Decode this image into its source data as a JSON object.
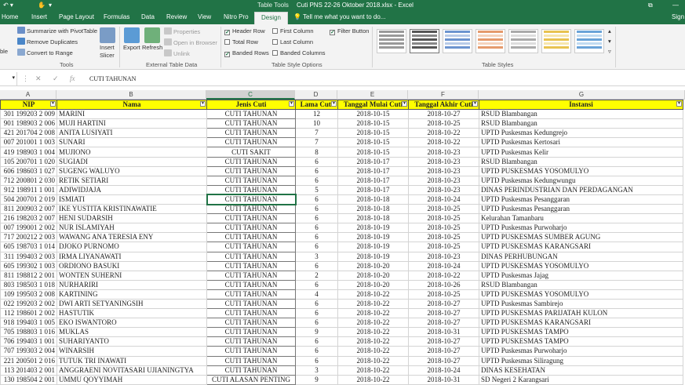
{
  "window": {
    "title": "Cuti PNS 22-26 Oktober 2018.xlsx - Excel",
    "context_tab": "Table Tools",
    "restore_icon": "restore-window-icon",
    "signin": "Sign"
  },
  "tabs": [
    "Home",
    "Insert",
    "Page Layout",
    "Formulas",
    "Data",
    "Review",
    "View",
    "Nitro Pro",
    "Design"
  ],
  "active_tab": "Design",
  "tell_me": "Tell me what you want to do...",
  "ribbon": {
    "tools": {
      "summarize": "Summarize with PivotTable",
      "remove_duplicates": "Remove Duplicates",
      "convert_range": "Convert to Range",
      "left_cut": "ble",
      "insert_slicer_1": "Insert",
      "insert_slicer_2": "Slicer",
      "group": "Tools"
    },
    "external": {
      "export": "Export",
      "refresh": "Refresh",
      "properties": "Properties",
      "open_browser": "Open in Browser",
      "unlink": "Unlink",
      "group": "External Table Data"
    },
    "style_options": {
      "header_row": "Header Row",
      "total_row": "Total Row",
      "banded_rows": "Banded Rows",
      "first_column": "First Column",
      "last_column": "Last Column",
      "banded_columns": "Banded Columns",
      "filter_button": "Filter Button",
      "group": "Table Style Options",
      "checked": {
        "header_row": true,
        "total_row": false,
        "banded_rows": true,
        "first_column": false,
        "last_column": false,
        "banded_columns": false,
        "filter_button": true
      }
    },
    "table_styles": {
      "group": "Table Styles"
    }
  },
  "formula_bar": {
    "namebox": "",
    "value": "CUTI TAHUNAN"
  },
  "columns": [
    "A",
    "B",
    "C",
    "D",
    "E",
    "F",
    "G"
  ],
  "selected_column": "C",
  "headers": [
    "NIP",
    "Nama",
    "Jenis Cuti",
    "Lama Cuti",
    "Tanggal Mulai Cuti",
    "Tanggal Akhir Cuti",
    "Instansi"
  ],
  "rows": [
    [
      "301 199203 2 009",
      "MARINI",
      "CUTI TAHUNAN",
      "12",
      "2018-10-15",
      "2018-10-27",
      "RSUD Blambangan"
    ],
    [
      "901 198903 2 006",
      "MUJI HARTINI",
      "CUTI TAHUNAN",
      "10",
      "2018-10-15",
      "2018-10-25",
      "RSUD Blambangan"
    ],
    [
      "421 201704 2 008",
      "ANITA LUSIYATI",
      "CUTI TAHUNAN",
      "7",
      "2018-10-15",
      "2018-10-22",
      "UPTD Puskesmas Kedungrejo"
    ],
    [
      "007 201001 1 003",
      "SUNARI",
      "CUTI TAHUNAN",
      "7",
      "2018-10-15",
      "2018-10-22",
      "UPTD Puskesmas Kertosari"
    ],
    [
      "419 198903 1 004",
      "MUJIONO",
      "CUTI SAKIT",
      "8",
      "2018-10-15",
      "2018-10-23",
      "UPTD Puskesmas Kelir"
    ],
    [
      "105 200701 1 020",
      "SUGIADI",
      "CUTI TAHUNAN",
      "6",
      "2018-10-17",
      "2018-10-23",
      "RSUD Blambangan"
    ],
    [
      "606 198603 1 027",
      "SUGENG WALUYO",
      "CUTI TAHUNAN",
      "6",
      "2018-10-17",
      "2018-10-23",
      "UPTD PUSKESMAS YOSOMULYO"
    ],
    [
      "712 200801 2 030",
      "RETIK SETIARI",
      "CUTI TAHUNAN",
      "6",
      "2018-10-17",
      "2018-10-23",
      "UPTD Puskesmas Kedungwungu"
    ],
    [
      "912 198911 1 001",
      "ADIWIDJAJA",
      "CUTI TAHUNAN",
      "5",
      "2018-10-17",
      "2018-10-23",
      "DINAS PERINDUSTRIAN DAN PERDAGANGAN"
    ],
    [
      "504 200701 2 019",
      "ISMIATI",
      "CUTI TAHUNAN",
      "6",
      "2018-10-18",
      "2018-10-24",
      "UPTD Puskesmas Pesanggaran"
    ],
    [
      "811 200903 2 007",
      "IKE YUSTITA KRISTINAWATIE",
      "CUTI TAHUNAN",
      "6",
      "2018-10-18",
      "2018-10-25",
      "UPTD Puskesmas Pesanggaran"
    ],
    [
      "216 198203 2 007",
      "HENI SUDARSIH",
      "CUTI TAHUNAN",
      "6",
      "2018-10-18",
      "2018-10-25",
      "Kelurahan Tamanbaru"
    ],
    [
      "007 199001 2 002",
      "NUR ISLAMIYAH",
      "CUTI TAHUNAN",
      "6",
      "2018-10-19",
      "2018-10-25",
      "UPTD Puskesmas Purwoharjo"
    ],
    [
      "717 200212 2 003",
      "WAWANG ANA TERESIA ENY",
      "CUTI TAHUNAN",
      "6",
      "2018-10-19",
      "2018-10-25",
      "UPTD PUSKESMAS SUMBER AGUNG"
    ],
    [
      "605 198703 1 014",
      "DJOKO PURNOMO",
      "CUTI TAHUNAN",
      "6",
      "2018-10-19",
      "2018-10-25",
      "UPTD PUSKESMAS KARANGSARI"
    ],
    [
      "311 199403 2 003",
      "IRMA LIYANAWATI",
      "CUTI TAHUNAN",
      "3",
      "2018-10-19",
      "2018-10-23",
      "DINAS PERHUBUNGAN"
    ],
    [
      "605 199302 1 003",
      "ORDIONO BASUKI",
      "CUTI TAHUNAN",
      "6",
      "2018-10-20",
      "2018-10-24",
      "UPTD PUSKESMAS YOSOMULYO"
    ],
    [
      "811 198812 2 001",
      "WONTEN SUHERNI",
      "CUTI TAHUNAN",
      "2",
      "2018-10-20",
      "2018-10-22",
      "UPTD Puskesmas Jajag"
    ],
    [
      "803 198503 1 018",
      "NURHARIRI",
      "CUTI TAHUNAN",
      "6",
      "2018-10-20",
      "2018-10-26",
      "RSUD Blambangan"
    ],
    [
      "109 199503 2 008",
      "KARTINING",
      "CUTI TAHUNAN",
      "4",
      "2018-10-22",
      "2018-10-25",
      "UPTD PUSKESMAS YOSOMULYO"
    ],
    [
      "022 199203 2 002",
      "DWI ARTI SETYANINGSIH",
      "CUTI TAHUNAN",
      "6",
      "2018-10-22",
      "2018-10-27",
      "UPTD Puskesmas Sambirejo"
    ],
    [
      "112 198601 2 002",
      "HASTUTIK",
      "CUTI TAHUNAN",
      "6",
      "2018-10-22",
      "2018-10-27",
      "UPTD PUSKESMAS PARIJATAH KULON"
    ],
    [
      "918 199403 1 005",
      "EKO ISWANTORO",
      "CUTI TAHUNAN",
      "6",
      "2018-10-22",
      "2018-10-27",
      "UPTD PUSKESMAS KARANGSARI"
    ],
    [
      "705 198803 1 016",
      "MUKLAS",
      "CUTI TAHUNAN",
      "9",
      "2018-10-22",
      "2018-10-31",
      "UPTD PUSKESMAS TAMPO"
    ],
    [
      "706 199403 1 001",
      "SUHARIYANTO",
      "CUTI TAHUNAN",
      "6",
      "2018-10-22",
      "2018-10-27",
      "UPTD PUSKESMAS TAMPO"
    ],
    [
      "707 199303 2 004",
      "WINARSIH",
      "CUTI TAHUNAN",
      "6",
      "2018-10-22",
      "2018-10-27",
      "UPTD Puskesmas Purwoharjo"
    ],
    [
      "221 200501 2 016",
      "TUTUK TRI INAWATI",
      "CUTI TAHUNAN",
      "6",
      "2018-10-22",
      "2018-10-27",
      "UPTD Puskesmas Siliragung"
    ],
    [
      "113 201403 2 001",
      "ANGGRAENI NOVITASARI UJIANINGTYA",
      "CUTI TAHUNAN",
      "3",
      "2018-10-22",
      "2018-10-24",
      "DINAS KESEHATAN"
    ],
    [
      "130 198504 2 001",
      "UMMU QOYYIMAH",
      "CUTI ALASAN PENTING",
      "9",
      "2018-10-22",
      "2018-10-31",
      "SD Negeri 2 Karangsari"
    ]
  ],
  "active_cell_row": 9,
  "colors": {
    "excel_green": "#217346",
    "header_fill": "#ffff00",
    "ribbon": "#f3f3f3"
  }
}
